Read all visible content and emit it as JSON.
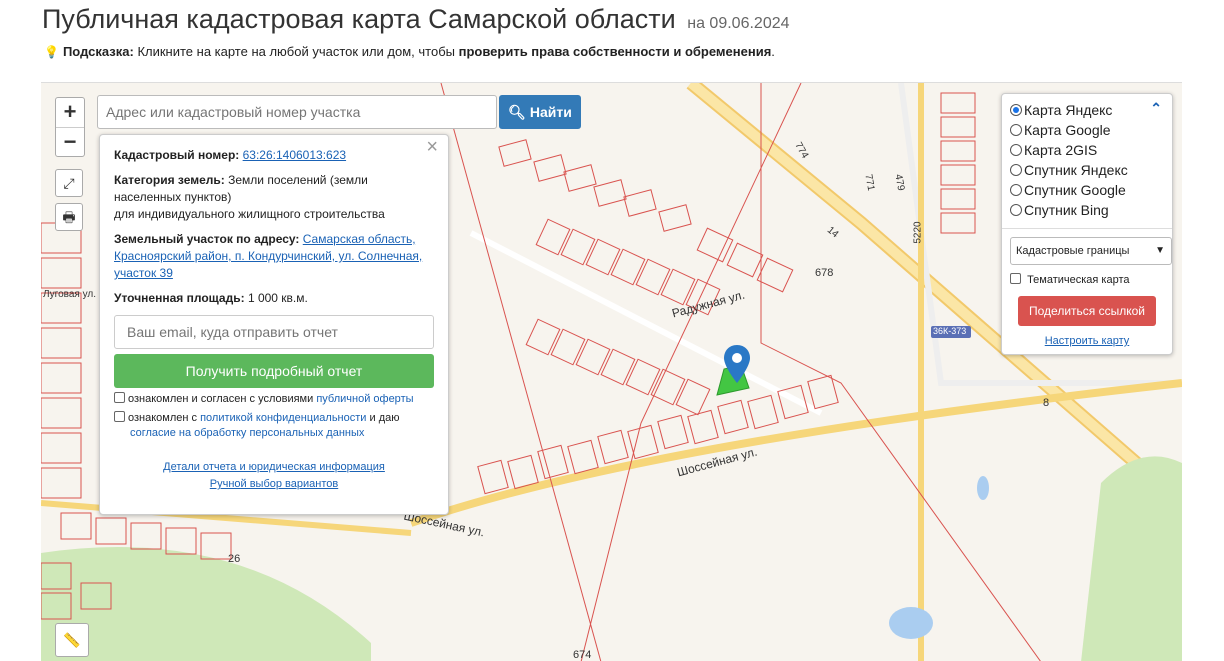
{
  "header": {
    "title": "Публичная кадастровая карта Самарской области",
    "date": "на 09.06.2024",
    "hint_label": "Подсказка:",
    "hint_text": "Кликните на карте на любой участок или дом, чтобы",
    "hint_bold": "проверить права собственности и обременения",
    "hint_end": "."
  },
  "map_controls": {
    "zoom_in": "+",
    "zoom_out": "−",
    "search_placeholder": "Адрес или кадастровый номер участка",
    "search_button": "Найти",
    "icons": [
      "zoom-in-icon",
      "zoom-out-icon",
      "fullscreen-icon",
      "print-icon",
      "ruler-icon",
      "search-icon"
    ]
  },
  "parcel_popup": {
    "cadastral_label": "Кадастровый номер:",
    "cadastral_number": "63:26:1406013:623",
    "category_label": "Категория земель:",
    "category_value": "Земли поселений (земли населенных пунктов)",
    "usage_value": "для индивидуального жилищного строительства",
    "address_label": "Земельный участок по адресу:",
    "address_value": "Самарская область, Красноярский район, п. Кондурчинский, ул. Солнечная, участок 39",
    "area_label": "Уточненная площадь:",
    "area_value": "1 000 кв.м.",
    "email_placeholder": "Ваш email, куда отправить отчет",
    "report_button": "Получить подробный отчет",
    "consent1_text": "ознакомлен и согласен с условиями",
    "consent1_link": "публичной оферты",
    "consent2_text": "ознакомлен с",
    "consent2_link": "политикой конфиденциальности",
    "consent2_mid": "и даю",
    "consent2_link2": "согласие на обработку персональных данных",
    "details_link": "Детали отчета и юридическая информация",
    "manual_link": "Ручной выбор вариантов"
  },
  "layers": {
    "options": [
      "Карта Яндекс",
      "Карта Google",
      "Карта 2GIS",
      "Спутник Яндекс",
      "Спутник Google",
      "Спутник Bing"
    ],
    "selected": "Карта Яндекс",
    "overlay_select": "Кадастровые границы",
    "thematic_label": "Тематическая карта",
    "share_button": "Поделиться ссылкой",
    "settings_link": "Настроить карту"
  },
  "map_labels": {
    "road_raduzhnaya": "Радужная ул.",
    "road_shosseynaya1": "Шоссейная ул.",
    "road_shosseynaya2": "Шоссейная ул.",
    "road_lugovaya": "Луговая ул.",
    "highway": "36К-373",
    "parcel_678": "678",
    "parcel_674": "674",
    "parcel_8": "8",
    "parcel_26": "26",
    "parcel_5220": "5220",
    "parcel_774": "774",
    "parcel_771": "771",
    "parcel_479": "479",
    "parcel_14": "14"
  },
  "colors": {
    "accent_blue": "#337ab7",
    "report_green": "#5cb85c",
    "share_red": "#d9534f",
    "parcel_border": "#d9534f",
    "selected_parcel": "#43c643",
    "road_yellow": "#f6d67a"
  }
}
